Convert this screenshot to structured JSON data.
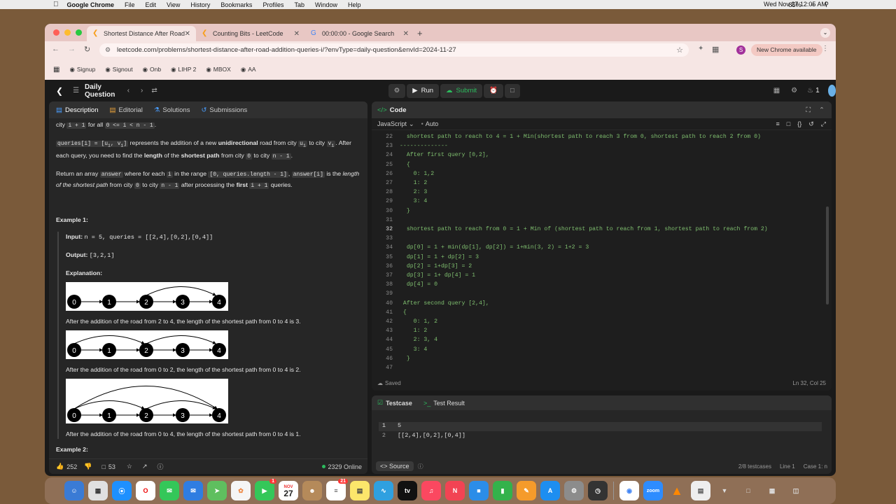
{
  "menubar": {
    "apple": "",
    "app": "Google Chrome",
    "items": [
      "File",
      "Edit",
      "View",
      "History",
      "Bookmarks",
      "Profiles",
      "Tab",
      "Window",
      "Help"
    ],
    "battery": "85%",
    "clock": "Wed Nov 27  12:05 AM"
  },
  "tabs": [
    {
      "title": "Shortest Distance After Road",
      "icon": "leetcode-icon"
    },
    {
      "title": "Counting Bits - LeetCode",
      "icon": "leetcode-icon"
    },
    {
      "title": "00:00:00 - Google Search",
      "icon": "google-icon"
    }
  ],
  "address": {
    "url": "leetcode.com/problems/shortest-distance-after-road-addition-queries-i/?envType=daily-question&envId=2024-11-27",
    "badge": "New Chrome available",
    "profile": "S"
  },
  "bookmarks": [
    "Signup",
    "Signout",
    "Onb",
    "LIHP 2",
    "MBOX",
    "AA"
  ],
  "lc": {
    "title": "Daily Question",
    "run": "Run",
    "submit": "Submit",
    "fire": "1"
  },
  "left": {
    "tabs": [
      "Description",
      "Editorial",
      "Solutions",
      "Submissions"
    ],
    "p1a": "city",
    "p1b": "i + 1",
    "p1c": "for all",
    "p1d": "0 <= i < n - 1",
    "p2a": "queries[i] = [u",
    "p2b": "represents the addition of a new",
    "p2c": "unidirectional",
    "p2d": "road from city",
    "p2e": "to city",
    "p2f": "After each query, you need to find the",
    "p2g": "length",
    "p2h": "of the",
    "p2i": "shortest path",
    "p2j": "from city",
    "p2k": "0",
    "p2l": "to city",
    "p2m": "n - 1",
    "p3a": "Return an array",
    "p3b": "answer",
    "p3c": "where for each",
    "p3d": "i",
    "p3e": "in the range",
    "p3f": "[0, queries.length - 1]",
    "p3g": "answer[i]",
    "p3h": "is the",
    "p3i": "length of the shortest path",
    "p3j": "from city",
    "p3k": "0",
    "p3l": "to city",
    "p3m": "n - 1",
    "p3n": "after processing the",
    "p3o": "first",
    "p3p": "i + 1",
    "p3q": "queries.",
    "ex1": "Example 1:",
    "input_label": "Input:",
    "input_val": "n = 5, queries = [[2,4],[0,2],[0,4]]",
    "output_label": "Output:",
    "output_val": "[3,2,1]",
    "expl": "Explanation:",
    "cap1": "After the addition of the road from 2 to 4, the length of the shortest path from 0 to 4 is 3.",
    "cap2": "After the addition of the road from 0 to 2, the length of the shortest path from 0 to 4 is 2.",
    "cap3": "After the addition of the road from 0 to 4, the length of the shortest path from 0 to 4 is 1.",
    "ex2": "Example 2:",
    "nodes": [
      "0",
      "1",
      "2",
      "3",
      "4"
    ],
    "likes": "252",
    "comments": "53",
    "online": "2329 Online"
  },
  "right": {
    "title": "Code",
    "lang": "JavaScript",
    "auto": "Auto",
    "saved": "Saved",
    "pos": "Ln 32, Col 25",
    "lines": [
      {
        "n": "22",
        "t": "  shortest path to reach to 4 = 1 + Min(shortest path to reach 3 from 0, shortest path to reach 2 from 0)"
      },
      {
        "n": "23",
        "t": "--------------"
      },
      {
        "n": "24",
        "t": "  After first query [0,2],"
      },
      {
        "n": "25",
        "t": "  {"
      },
      {
        "n": "26",
        "t": "    0: 1,2"
      },
      {
        "n": "27",
        "t": "    1: 2"
      },
      {
        "n": "28",
        "t": "    2: 3"
      },
      {
        "n": "29",
        "t": "    3: 4"
      },
      {
        "n": "30",
        "t": "  }"
      },
      {
        "n": "31",
        "t": ""
      },
      {
        "n": "32",
        "t": "  shortest path to reach from 0 = 1 + Min of (shortest path to reach from 1, shortest path to reach from 2)"
      },
      {
        "n": "33",
        "t": ""
      },
      {
        "n": "34",
        "t": "  dp[0] = 1 + min(dp[1], dp[2]) = 1+min(3, 2) = 1+2 = 3"
      },
      {
        "n": "35",
        "t": "  dp[1] = 1 + dp[2] = 3"
      },
      {
        "n": "36",
        "t": "  dp[2] = 1+dp[3] = 2"
      },
      {
        "n": "37",
        "t": "  dp[3] = 1+ dp[4] = 1"
      },
      {
        "n": "38",
        "t": "  dp[4] = 0"
      },
      {
        "n": "39",
        "t": ""
      },
      {
        "n": "40",
        "t": " After second query [2,4],"
      },
      {
        "n": "41",
        "t": " {"
      },
      {
        "n": "42",
        "t": "    0: 1, 2"
      },
      {
        "n": "43",
        "t": "    1: 2"
      },
      {
        "n": "44",
        "t": "    2: 3, 4"
      },
      {
        "n": "45",
        "t": "    3: 4"
      },
      {
        "n": "46",
        "t": "  }"
      },
      {
        "n": "47",
        "t": ""
      }
    ]
  },
  "bottom": {
    "tab1": "Testcase",
    "tab2": "Test Result",
    "l1": "1",
    "v1": "5",
    "l2": "2",
    "v2": "[[2,4],[0,2],[0,4]]",
    "source": "Source",
    "cases": "2/8 testcases",
    "line": "Line 1",
    "case": "Case 1: n"
  },
  "dock": {
    "calendar_month": "NOV",
    "calendar_day": "27",
    "facetime_badge": "1",
    "reminders_badge": "21"
  },
  "colors": {
    "accent": "#2cbb5d",
    "editor_text": "#7fbf6f",
    "bg": "#1a1a1a"
  }
}
